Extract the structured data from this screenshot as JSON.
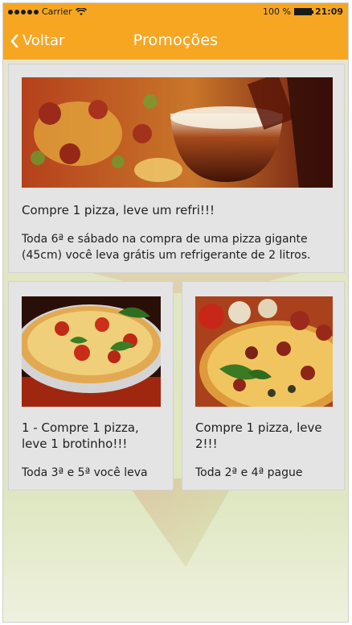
{
  "status_bar": {
    "carrier": "Carrier",
    "battery_percent": "100 %",
    "time": "21:09"
  },
  "nav": {
    "back_label": "Voltar",
    "title": "Promoções"
  },
  "colors": {
    "accent": "#f7a622",
    "card_bg": "#e4e4e4"
  },
  "promotions": [
    {
      "title": "Compre 1 pizza, leve um refri!!!",
      "description": "Toda 6ª e sábado na compra de uma pizza gigante (45cm) você leva grátis um refrigerante de 2 litros."
    },
    {
      "title": "1 - Compre 1 pizza, leve 1 brotinho!!!",
      "description": "Toda 3ª e 5ª você leva"
    },
    {
      "title": "Compre 1 pizza, leve 2!!!",
      "description": "Toda 2ª e 4ª pague"
    }
  ]
}
